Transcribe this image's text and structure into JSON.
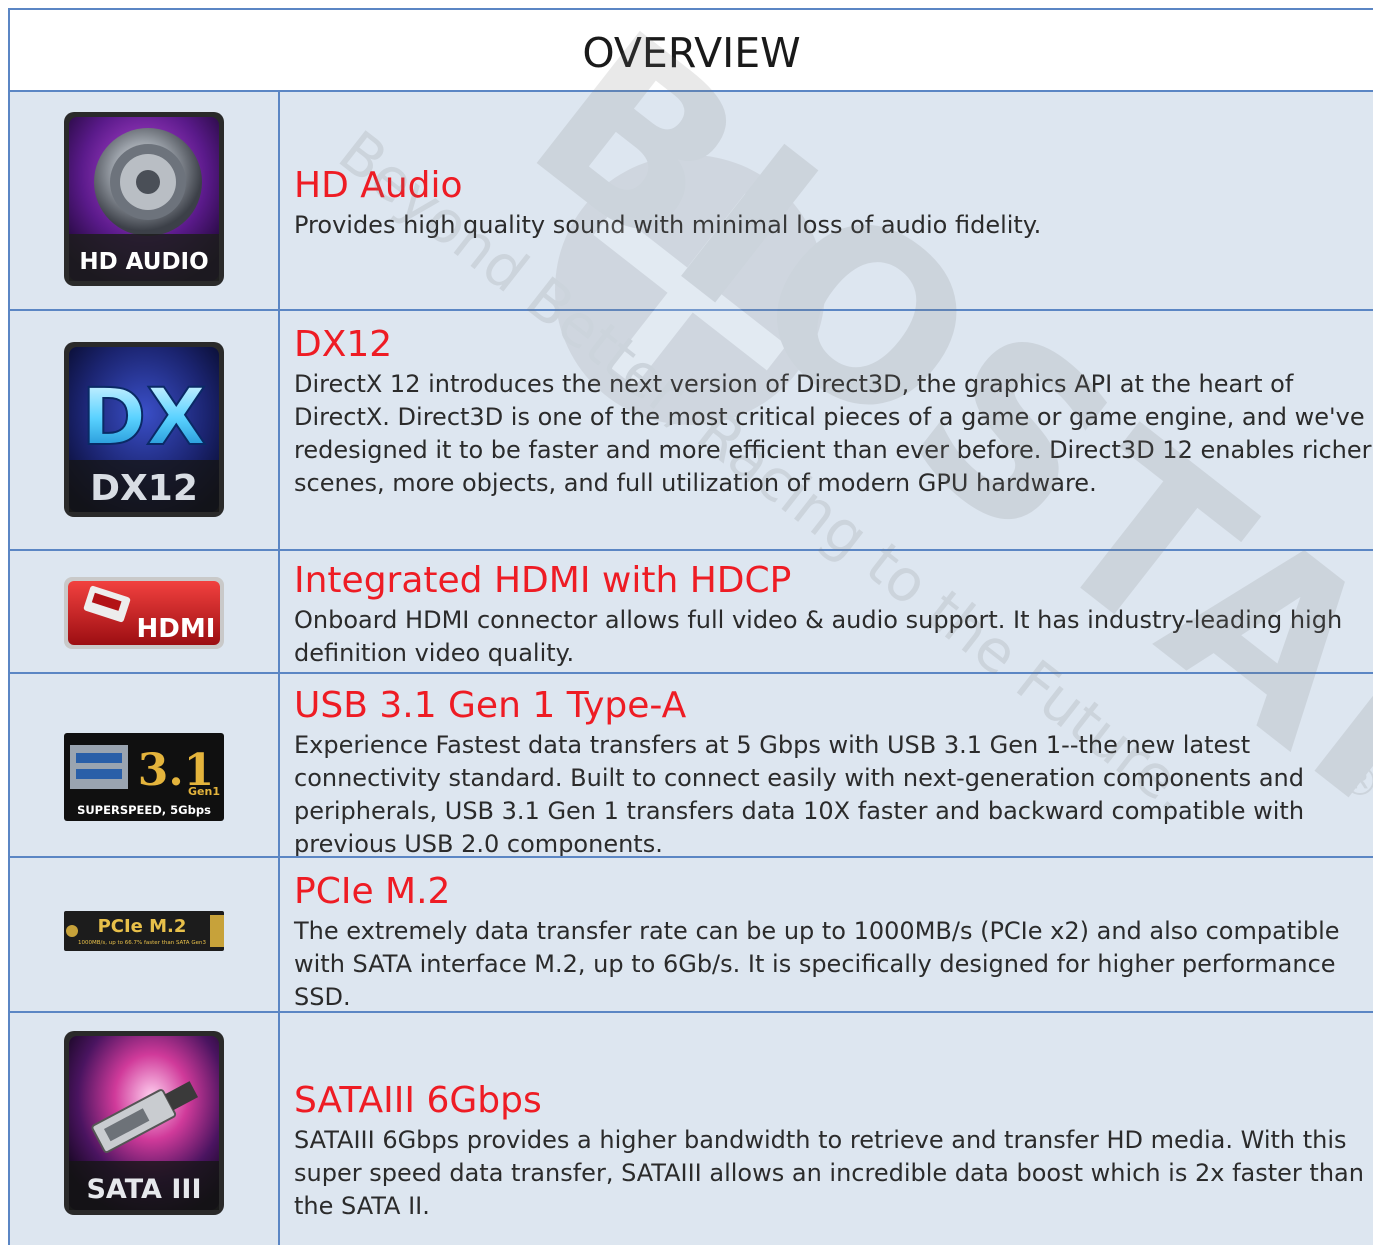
{
  "header": {
    "title": "OVERVIEW"
  },
  "features": [
    {
      "title": "HD Audio",
      "description": "Provides high quality sound with minimal loss of audio fidelity.",
      "icon": {
        "name": "hd-audio-icon",
        "label": "HD AUDIO"
      }
    },
    {
      "title": "DX12",
      "description": "DirectX 12 introduces the next version of Direct3D, the graphics API at the heart of DirectX. Direct3D is one of the most critical pieces of a game or game engine, and we've redesigned it to be faster and more efficient than ever before. Direct3D 12 enables richer scenes, more objects, and full utilization of modern GPU hardware.",
      "icon": {
        "name": "dx12-icon",
        "label": "DX12",
        "big": "DX"
      }
    },
    {
      "title": "Integrated HDMI with HDCP",
      "description": "Onboard HDMI connector allows full video & audio support. It has industry-leading high definition video quality.",
      "icon": {
        "name": "hdmi-icon",
        "label": "HDMI"
      }
    },
    {
      "title": "USB 3.1 Gen 1 Type-A",
      "description": "Experience Fastest data transfers at 5 Gbps with USB 3.1 Gen 1--the new latest connectivity standard. Built to connect easily with next-generation components and peripherals, USB 3.1 Gen 1 transfers data 10X faster and backward compatible with previous USB 2.0 components.",
      "icon": {
        "name": "usb-3-1-icon",
        "label": "3.1",
        "sub": "Gen1",
        "caption": "SUPERSPEED, 5Gbps"
      }
    },
    {
      "title": "PCIe M.2",
      "description": "The extremely data transfer rate can be up to 1000MB/s (PCIe x2) and also compatible with SATA interface M.2, up to 6Gb/s. It is specifically designed for higher performance SSD.",
      "icon": {
        "name": "pcie-m2-icon",
        "label": "PCIe M.2",
        "caption": "1000MB/s, up to 66.7% faster than SATA Gen3"
      }
    },
    {
      "title": "SATAIII 6Gbps",
      "description": "SATAIII 6Gbps provides a higher bandwidth to retrieve and transfer HD media. With this super speed data transfer, SATAIII allows an incredible data boost which is 2x faster than the SATA II.",
      "icon": {
        "name": "sata-iii-icon",
        "label": "SATA III"
      }
    }
  ],
  "watermark": {
    "logo": "BIOSTAR",
    "tagline": "Beyond Better, Racing to the Future.",
    "mark": "®"
  }
}
